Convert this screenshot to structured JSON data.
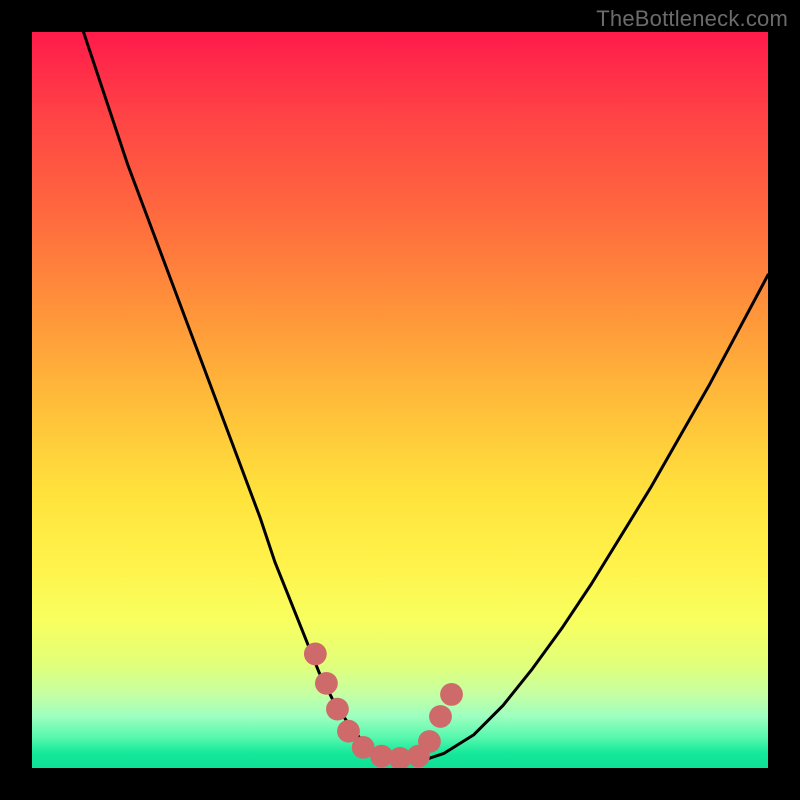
{
  "watermark": {
    "text": "TheBottleneck.com"
  },
  "chart_data": {
    "type": "line",
    "title": "",
    "xlabel": "",
    "ylabel": "",
    "xlim": [
      0,
      100
    ],
    "ylim": [
      0,
      100
    ],
    "series": [
      {
        "name": "curve",
        "x": [
          7,
          10,
          13,
          16,
          19,
          22,
          25,
          28,
          31,
          33,
          35,
          37,
          39,
          41,
          43,
          45,
          47,
          50,
          53,
          56,
          60,
          64,
          68,
          72,
          76,
          80,
          84,
          88,
          92,
          96,
          100
        ],
        "y": [
          100,
          91,
          82,
          74,
          66,
          58,
          50,
          42,
          34,
          28,
          23,
          18,
          13,
          9,
          6,
          3.5,
          2,
          1,
          1,
          2,
          4.5,
          8.5,
          13.5,
          19,
          25,
          31.5,
          38,
          45,
          52,
          59.5,
          67
        ]
      }
    ],
    "markers": {
      "name": "bottom-cluster",
      "color": "#cf6a6a",
      "radius_pct": 1.55,
      "points": [
        {
          "x": 38.5,
          "y": 15.5
        },
        {
          "x": 40.0,
          "y": 11.5
        },
        {
          "x": 41.5,
          "y": 8.0
        },
        {
          "x": 43.0,
          "y": 5.0
        },
        {
          "x": 45.0,
          "y": 2.8
        },
        {
          "x": 47.5,
          "y": 1.6
        },
        {
          "x": 50.0,
          "y": 1.3
        },
        {
          "x": 52.5,
          "y": 1.6
        },
        {
          "x": 54.0,
          "y": 3.6
        },
        {
          "x": 55.5,
          "y": 7.0
        },
        {
          "x": 57.0,
          "y": 10.0
        }
      ]
    }
  }
}
